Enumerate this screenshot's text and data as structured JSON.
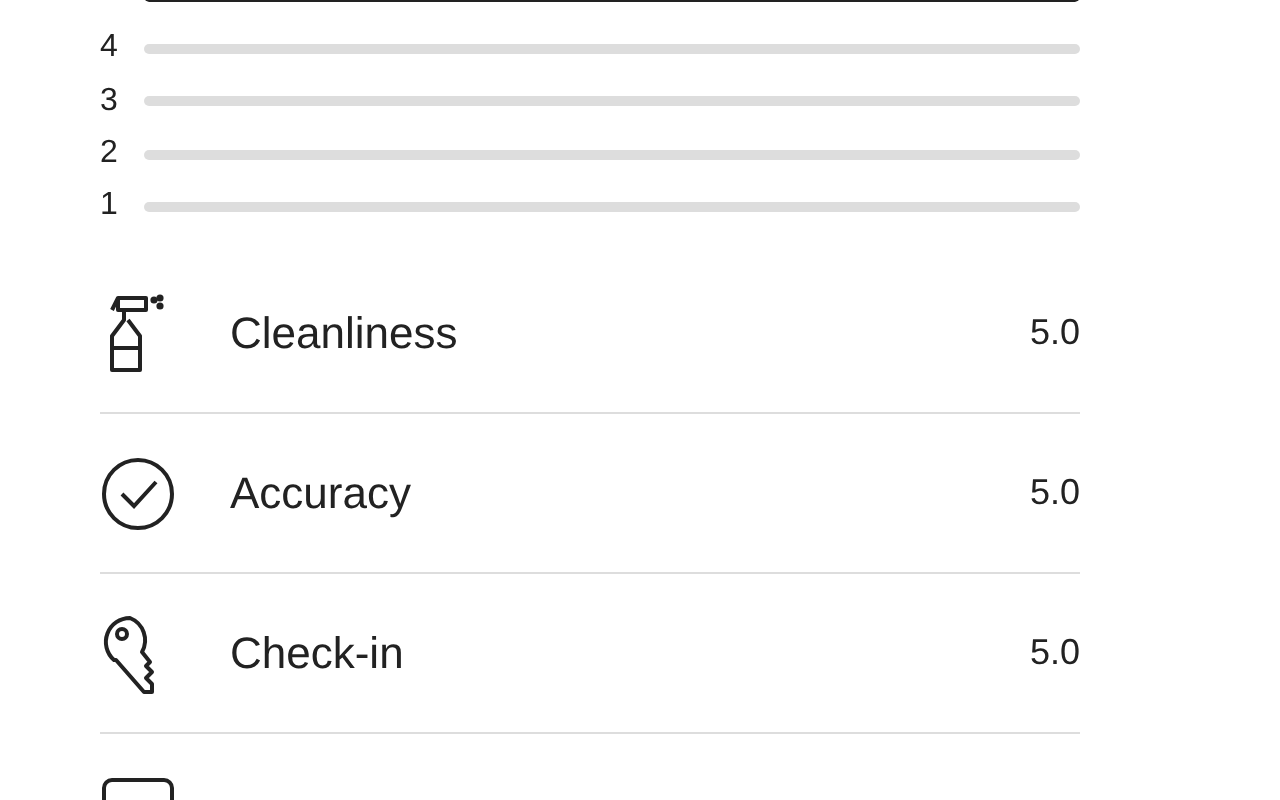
{
  "rating_bars": [
    {
      "level": 1
    },
    {
      "label": "4",
      "level": 0
    },
    {
      "label": "3",
      "level": 0
    },
    {
      "label": "2",
      "level": 0
    },
    {
      "label": "1",
      "level": 0
    }
  ],
  "categories": [
    {
      "kind": "spray",
      "label": "Cleanliness",
      "score": "5.0"
    },
    {
      "kind": "check",
      "label": "Accuracy",
      "score": "5.0"
    },
    {
      "kind": "key",
      "label": "Check-in",
      "score": "5.0"
    },
    {
      "kind": "chat"
    }
  ]
}
